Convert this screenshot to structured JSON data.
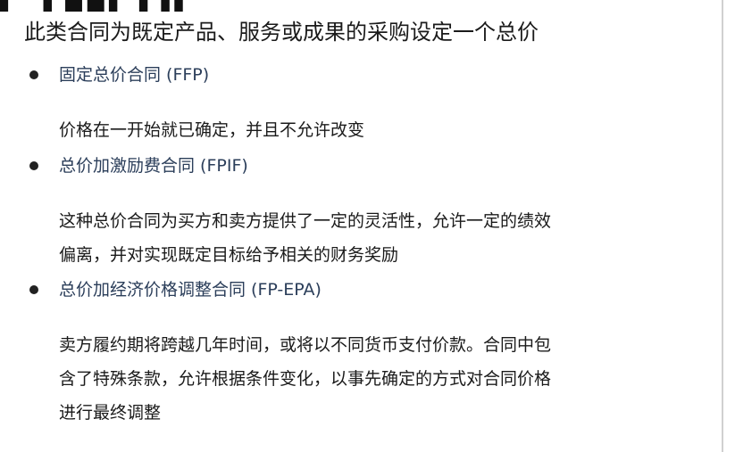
{
  "slide": {
    "top_cut_text": "▌▀▌▄▙▌▐▜▌",
    "heading": "此类合同为既定产品、服务或成果的采购设定一个总价",
    "items": [
      {
        "title": "固定总价合同 (FFP)",
        "desc_lines": [
          "价格在一开始就已确定，并且不允许改变"
        ]
      },
      {
        "title": "总价加激励费合同 (FPIF)",
        "desc_lines": [
          "这种总价合同为买方和卖方提供了一定的灵活性，允许一定的绩效",
          "偏离，并对实现既定目标给予相关的财务奖励"
        ]
      },
      {
        "title": "总价加经济价格调整合同 (FP-EPA)",
        "desc_lines": [
          "卖方履约期将跨越几年时间，或将以不同货币支付价款。合同中包",
          "含了特殊条款，允许根据条件变化，以事先确定的方式对合同价格",
          "进行最终调整"
        ]
      }
    ]
  },
  "colors": {
    "heading": "#1a1a1a",
    "item_title": "#2b3e5a",
    "body_text": "#1a1a1a",
    "bullet": "#222222"
  }
}
